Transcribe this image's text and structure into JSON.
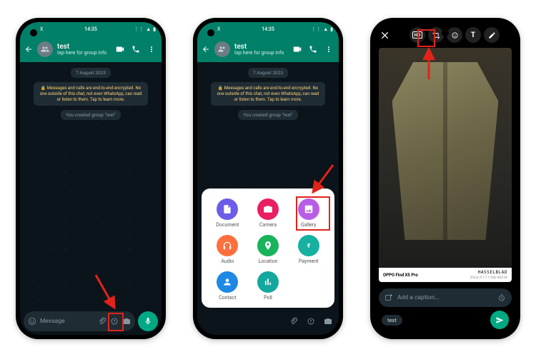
{
  "status": {
    "time": "14:35",
    "x_icon": "X",
    "signal": "⸬",
    "battery": "▮"
  },
  "chat": {
    "title": "test",
    "subtitle": "tap here for group info",
    "date_pill": "7 August 2023",
    "encryption_notice": "🔒 Messages and calls are end-to-end encrypted. No one outside of this chat, not even WhatsApp, can read or listen to them. Tap to learn more.",
    "system_msg": "You created group \"test\"",
    "input_placeholder": "Message"
  },
  "attach": {
    "items": [
      {
        "label": "Document",
        "color": "#6c5ce7"
      },
      {
        "label": "Camera",
        "color": "#e91e63"
      },
      {
        "label": "Gallery",
        "color": "#b85ee6"
      },
      {
        "label": "Audio",
        "color": "#ff6f3c"
      },
      {
        "label": "Location",
        "color": "#18b35b"
      },
      {
        "label": "Payment",
        "color": "#17b1a1"
      },
      {
        "label": "Contact",
        "color": "#1e88e5"
      },
      {
        "label": "Poll",
        "color": "#13a89e"
      }
    ]
  },
  "editor": {
    "device_label": "OPPO Find X5 Pro",
    "camera_brand": "HASSELBLAD",
    "camera_meta": "23mm f/1.7 1/50s ISO100",
    "caption_placeholder": "Add a caption...",
    "recipient": "test"
  }
}
